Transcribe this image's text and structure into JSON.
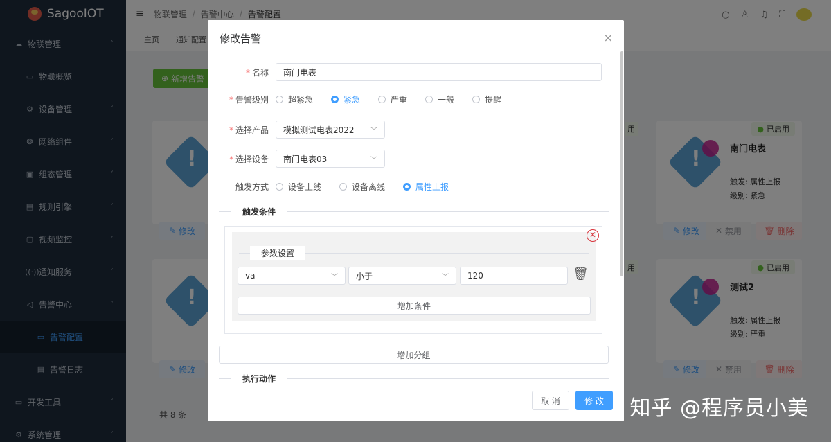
{
  "app": {
    "name": "SagooIOT"
  },
  "sidebar": {
    "items": [
      {
        "label": "物联管理",
        "icon": "cloud-icon",
        "glyph": "☁",
        "arrow": "˄",
        "level": 0
      },
      {
        "label": "物联概览",
        "icon": "monitor-icon",
        "glyph": "▭",
        "arrow": "",
        "level": 1
      },
      {
        "label": "设备管理",
        "icon": "cluster-icon",
        "glyph": "⚙",
        "arrow": "˅",
        "level": 1
      },
      {
        "label": "网络组件",
        "icon": "network-icon",
        "glyph": "❂",
        "arrow": "˅",
        "level": 1
      },
      {
        "label": "组态管理",
        "icon": "grid-icon",
        "glyph": "▣",
        "arrow": "˅",
        "level": 1
      },
      {
        "label": "规则引擎",
        "icon": "rules-icon",
        "glyph": "▤",
        "arrow": "˅",
        "level": 1
      },
      {
        "label": "视频监控",
        "icon": "camera-icon",
        "glyph": "▢",
        "arrow": "˅",
        "level": 1
      },
      {
        "label": "通知服务",
        "icon": "broadcast-icon",
        "glyph": "((·))",
        "arrow": "˅",
        "level": 1
      },
      {
        "label": "告警中心",
        "icon": "alarm-icon",
        "glyph": "◁",
        "arrow": "˄",
        "level": 1
      },
      {
        "label": "告警配置",
        "icon": "config-icon",
        "glyph": "▭",
        "arrow": "",
        "level": 2,
        "active": true
      },
      {
        "label": "告警日志",
        "icon": "log-icon",
        "glyph": "▤",
        "arrow": "",
        "level": 2
      },
      {
        "label": "开发工具",
        "icon": "folder-icon",
        "glyph": "▭",
        "arrow": "˅",
        "level": 0
      },
      {
        "label": "系统管理",
        "icon": "settings-icon",
        "glyph": "⚙",
        "arrow": "˅",
        "level": 0
      }
    ]
  },
  "header": {
    "breadcrumb": [
      "物联管理",
      "告警中心",
      "告警配置"
    ],
    "separator": "/"
  },
  "tags": [
    "主页",
    "通知配置"
  ],
  "background": {
    "add_button": "新增告警",
    "cards": [
      {
        "title": "南门电表",
        "status": "已启用",
        "trigger": "触发: 属性上报",
        "level": "级别: 紧急"
      },
      {
        "title": "测试2",
        "status": "已启用",
        "trigger": "触发: 属性上报",
        "level": "级别: 严重"
      }
    ],
    "partial_status": "用",
    "edit_label": "修改",
    "disable_label": "禁用",
    "delete_label": "删除",
    "total": "共 8 条"
  },
  "modal": {
    "title": "修改告警",
    "close": "×",
    "fields": {
      "name_label": "名称",
      "name_value": "南门电表",
      "level_label": "告警级别",
      "level_options": [
        "超紧急",
        "紧急",
        "严重",
        "一般",
        "提醒"
      ],
      "level_selected": 1,
      "product_label": "选择产品",
      "product_value": "模拟测试电表2022",
      "device_label": "选择设备",
      "device_value": "南门电表03",
      "trigger_label": "触发方式",
      "trigger_options": [
        "设备上线",
        "设备离线",
        "属性上报"
      ],
      "trigger_selected": 2
    },
    "trigger_condition_title": "触发条件",
    "param_title": "参数设置",
    "condition": {
      "param": "va",
      "operator": "小于",
      "value": "120"
    },
    "add_condition": "增加条件",
    "add_group": "增加分组",
    "action_title": "执行动作",
    "cancel": "取 消",
    "confirm": "修 改"
  },
  "watermark": "知乎 @程序员小美"
}
